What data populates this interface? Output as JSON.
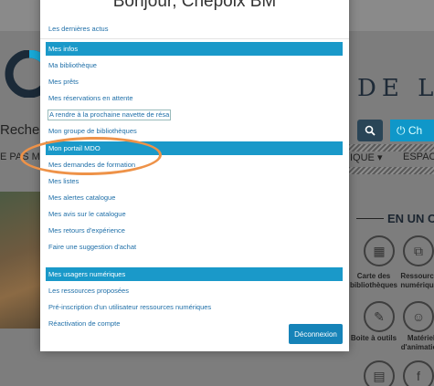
{
  "background": {
    "brand_text": "DE L'C",
    "search_placeholder": "Reche",
    "search_icon": "search-icon",
    "power_button": "Ch",
    "nav_left": "E PAS M",
    "nav_right_1": "IQUE ▾",
    "nav_right_2": "ESPAC",
    "section_title": "EN UN CI",
    "tiles": [
      {
        "label_1": "Carte des",
        "label_2": "bibliothèques"
      },
      {
        "label_1": "Ressources",
        "label_2": "numériques"
      },
      {
        "label_1": "Boite à outils",
        "label_2": ""
      },
      {
        "label_1": "Matériel",
        "label_2": "d'animation"
      }
    ]
  },
  "modal": {
    "greeting": "Bonjour, Chepoix BM",
    "top_link": "Les dernières actus",
    "sections": [
      {
        "title": "Mes infos",
        "links": [
          "Ma bibliothèque",
          "Mes prêts",
          "Mes réservations en attente",
          "A rendre à la prochaine navette de résa",
          "Mon groupe de bibliothèques"
        ]
      },
      {
        "title": "Mon portail MDO",
        "links": [
          "Mes demandes de formation",
          "Mes listes",
          "Mes alertes catalogue",
          "Mes avis sur le catalogue",
          "Mes retours d'expérience",
          "Faire une suggestion d'achat"
        ]
      },
      {
        "title": "Mes usagers numériques",
        "links": [
          "Les ressources proposées",
          "Pré-inscription d'un utilisateur ressources numériques",
          "Réactivation de compte"
        ]
      }
    ],
    "logout_label": "Déconnexion"
  },
  "annotation": {
    "color": "#ee9248"
  }
}
